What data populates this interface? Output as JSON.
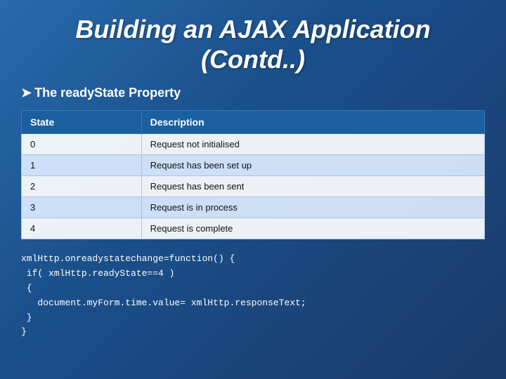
{
  "title": {
    "line1": "Building an AJAX Application",
    "line2": "(Contd..)"
  },
  "subtitle": "The readyState Property",
  "table": {
    "headers": [
      "State",
      "Description"
    ],
    "rows": [
      {
        "state": "0",
        "description": "Request not initialised"
      },
      {
        "state": "1",
        "description": "Request has been set up"
      },
      {
        "state": "2",
        "description": "Request has been sent"
      },
      {
        "state": "3",
        "description": "Request is in process"
      },
      {
        "state": "4",
        "description": "Request is complete"
      }
    ]
  },
  "code": {
    "lines": [
      "xmlHttp.onreadystatechange=function() {",
      " if( xmlHttp.readyState==4 )",
      " {",
      "   document.myForm.time.value= xmlHttp.responseText;",
      " }",
      "}"
    ]
  }
}
